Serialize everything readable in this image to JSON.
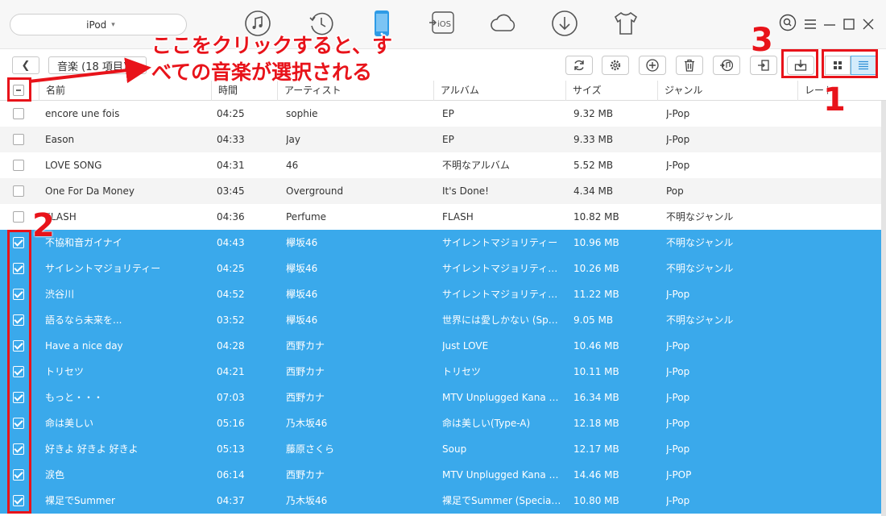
{
  "device": {
    "name": "iPod"
  },
  "nav_icons": [
    "music-icon",
    "history-icon",
    "phone-icon",
    "ios-transfer-icon",
    "cloud-icon",
    "download-icon",
    "tshirt-icon"
  ],
  "ios_label": "iOS",
  "toolbar": {
    "category": "音楽 (18 項目)"
  },
  "columns": [
    "名前",
    "時間",
    "アーティスト",
    "アルバム",
    "サイズ",
    "ジャンル",
    "レート"
  ],
  "rows": [
    {
      "name": "encore une fois",
      "time": "04:25",
      "artist": "sophie",
      "album": "EP",
      "size": "9.32 MB",
      "genre": "J-Pop",
      "selected": false
    },
    {
      "name": "Eason",
      "time": "04:33",
      "artist": "Jay",
      "album": " EP",
      "size": "9.33 MB",
      "genre": "J-Pop",
      "selected": false
    },
    {
      "name": "LOVE SONG",
      "time": "04:31",
      "artist": "46",
      "album": "不明なアルバム",
      "size": "5.52 MB",
      "genre": "J-Pop",
      "selected": false
    },
    {
      "name": "One For Da Money",
      "time": "03:45",
      "artist": "Overground",
      "album": "It's Done!",
      "size": "4.34 MB",
      "genre": "Pop",
      "selected": false
    },
    {
      "name": "FLASH",
      "time": "04:36",
      "artist": "Perfume",
      "album": "FLASH",
      "size": "10.82 MB",
      "genre": "不明なジャンル",
      "selected": false
    },
    {
      "name": "不協和音ガイナイ",
      "time": "04:43",
      "artist": "欅坂46",
      "album": "サイレントマジョリティー",
      "size": "10.96 MB",
      "genre": "不明なジャンル",
      "selected": true
    },
    {
      "name": "サイレントマジョリティー",
      "time": "04:25",
      "artist": "欅坂46",
      "album": "サイレントマジョリティー(TYPE...",
      "size": "10.26 MB",
      "genre": "不明なジャンル",
      "selected": true
    },
    {
      "name": "渋谷川",
      "time": "04:52",
      "artist": "欅坂46",
      "album": "サイレントマジョリティー (Spec...",
      "size": "11.22 MB",
      "genre": "J-Pop",
      "selected": true
    },
    {
      "name": "語るなら未来を...",
      "time": "03:52",
      "artist": "欅坂46",
      "album": "世界には愛しかない (Specia...",
      "size": "9.05 MB",
      "genre": "不明なジャンル",
      "selected": true
    },
    {
      "name": "Have a nice day",
      "time": "04:28",
      "artist": "西野カナ",
      "album": "Just LOVE",
      "size": "10.46 MB",
      "genre": "J-Pop",
      "selected": true
    },
    {
      "name": "トリセツ",
      "time": "04:21",
      "artist": "西野カナ",
      "album": "トリセツ",
      "size": "10.11 MB",
      "genre": "J-Pop",
      "selected": true
    },
    {
      "name": "もっと・・・",
      "time": "07:03",
      "artist": "西野カナ",
      "album": "MTV Unplugged Kana Ni...",
      "size": "16.34 MB",
      "genre": "J-Pop",
      "selected": true
    },
    {
      "name": "命は美しい",
      "time": "05:16",
      "artist": "乃木坂46",
      "album": "命は美しい(Type-A)",
      "size": "12.18 MB",
      "genre": "J-Pop",
      "selected": true
    },
    {
      "name": "好きよ 好きよ 好きよ",
      "time": "05:13",
      "artist": "藤原さくら",
      "album": "Soup",
      "size": "12.17 MB",
      "genre": "J-Pop",
      "selected": true
    },
    {
      "name": "涙色",
      "time": "06:14",
      "artist": "西野カナ",
      "album": "MTV Unplugged Kana Ni...",
      "size": "14.46 MB",
      "genre": "J-POP",
      "selected": true
    },
    {
      "name": "裸足でSummer",
      "time": "04:37",
      "artist": "乃木坂46",
      "album": "裸足でSummer (Special E...",
      "size": "10.80 MB",
      "genre": "J-Pop",
      "selected": true
    }
  ],
  "annotations": {
    "callout_line1": "ここをクリックすると、す",
    "callout_line2": "べての音楽が選択される",
    "num1": "1",
    "num2": "2",
    "num3": "3",
    "color": "#e8131a"
  },
  "colors": {
    "selection": "#3aa9eb",
    "accent": "#58b0e8"
  }
}
